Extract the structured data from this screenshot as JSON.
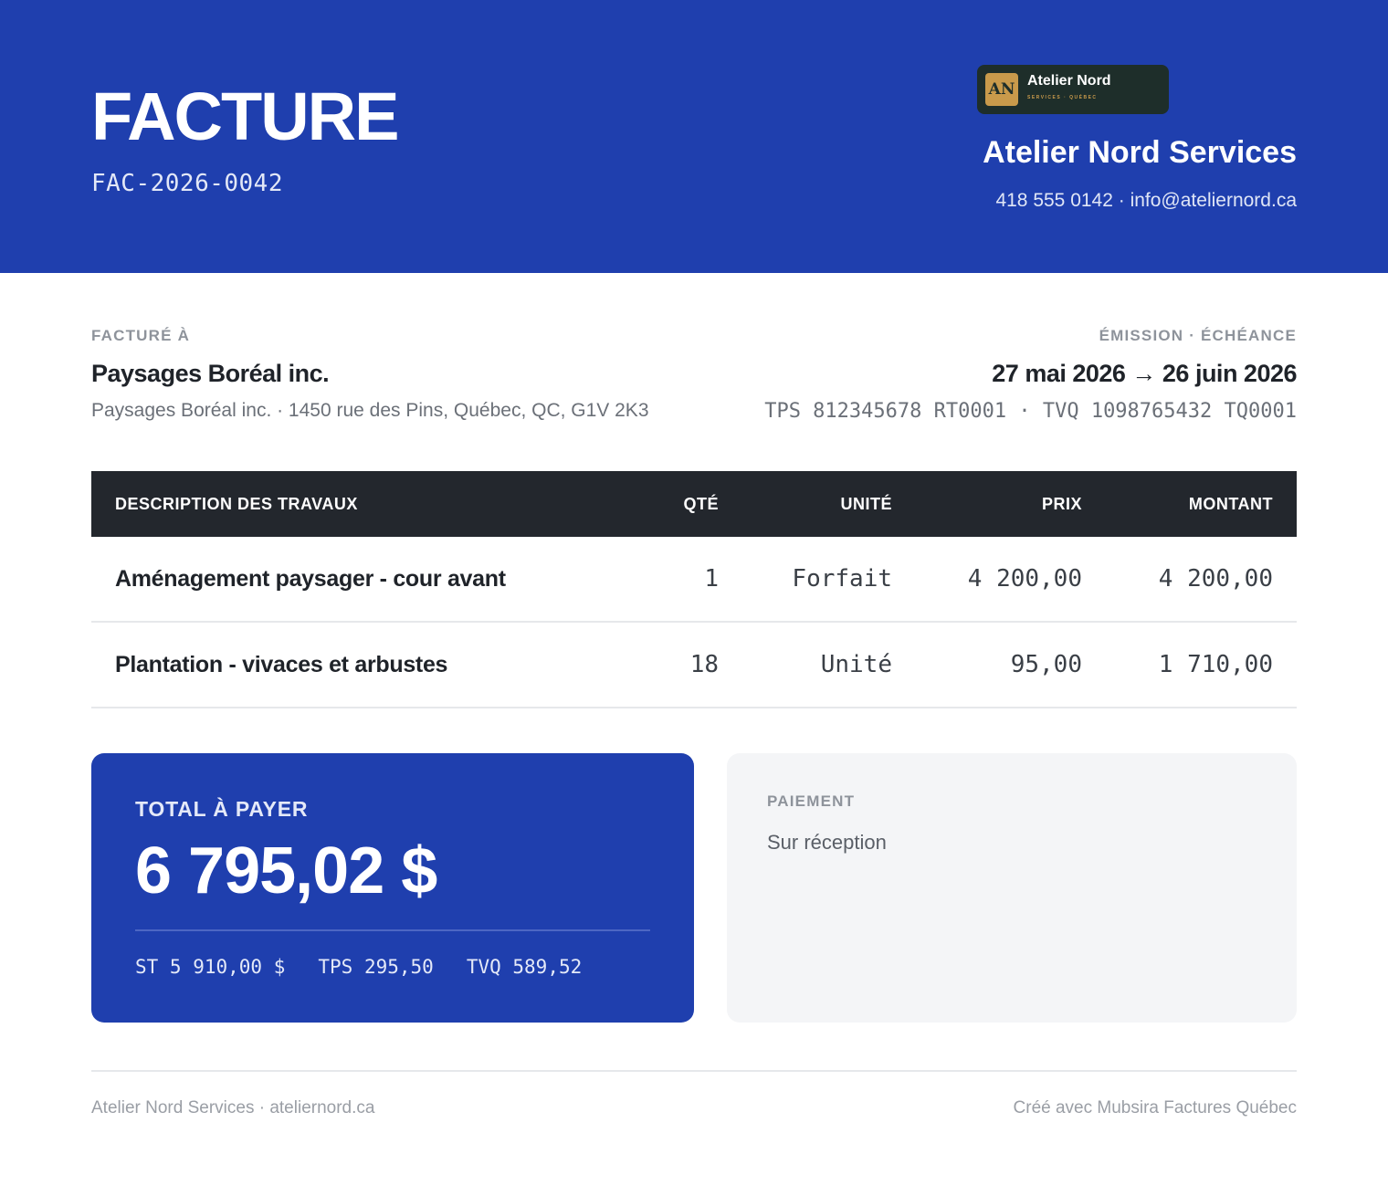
{
  "header": {
    "title": "FACTURE",
    "invoice_number": "FAC-2026-0042",
    "logo": {
      "initials": "AN",
      "name": "Atelier Nord",
      "subtitle": "SERVICES · QUÉBEC"
    },
    "company_name": "Atelier Nord Services",
    "contact": "418 555 0142 · info@ateliernord.ca"
  },
  "billing": {
    "label": "FACTURÉ À",
    "client_name": "Paysages Boréal inc.",
    "client_address": "Paysages Boréal inc. · 1450 rue des Pins, Québec, QC, G1V 2K3"
  },
  "dates": {
    "label": "ÉMISSION · ÉCHÉANCE",
    "range": "27 mai 2026 → 26 juin 2026",
    "tax_ids": "TPS 812345678 RT0001 · TVQ 1098765432 TQ0001"
  },
  "table": {
    "headers": {
      "description": "DESCRIPTION DES TRAVAUX",
      "qty": "QTÉ",
      "unit": "UNITÉ",
      "price": "PRIX",
      "amount": "MONTANT"
    },
    "rows": [
      {
        "description": "Aménagement paysager - cour avant",
        "qty": "1",
        "unit": "Forfait",
        "price": "4 200,00",
        "amount": "4 200,00"
      },
      {
        "description": "Plantation - vivaces et arbustes",
        "qty": "18",
        "unit": "Unité",
        "price": "95,00",
        "amount": "1 710,00"
      }
    ]
  },
  "total": {
    "label": "TOTAL À PAYER",
    "value": "6 795,02 $",
    "subtotal": "ST 5 910,00 $",
    "tps": "TPS 295,50",
    "tvq": "TVQ 589,52"
  },
  "payment": {
    "label": "PAIEMENT",
    "value": "Sur réception"
  },
  "footer": {
    "left": "Atelier Nord Services · ateliernord.ca",
    "right": "Créé avec Mubsira Factures Québec"
  },
  "colors": {
    "brand_blue": "#1f3fae",
    "table_header": "#23272d",
    "logo_bg": "#1e2e2a",
    "logo_gold": "#c99a4b"
  }
}
